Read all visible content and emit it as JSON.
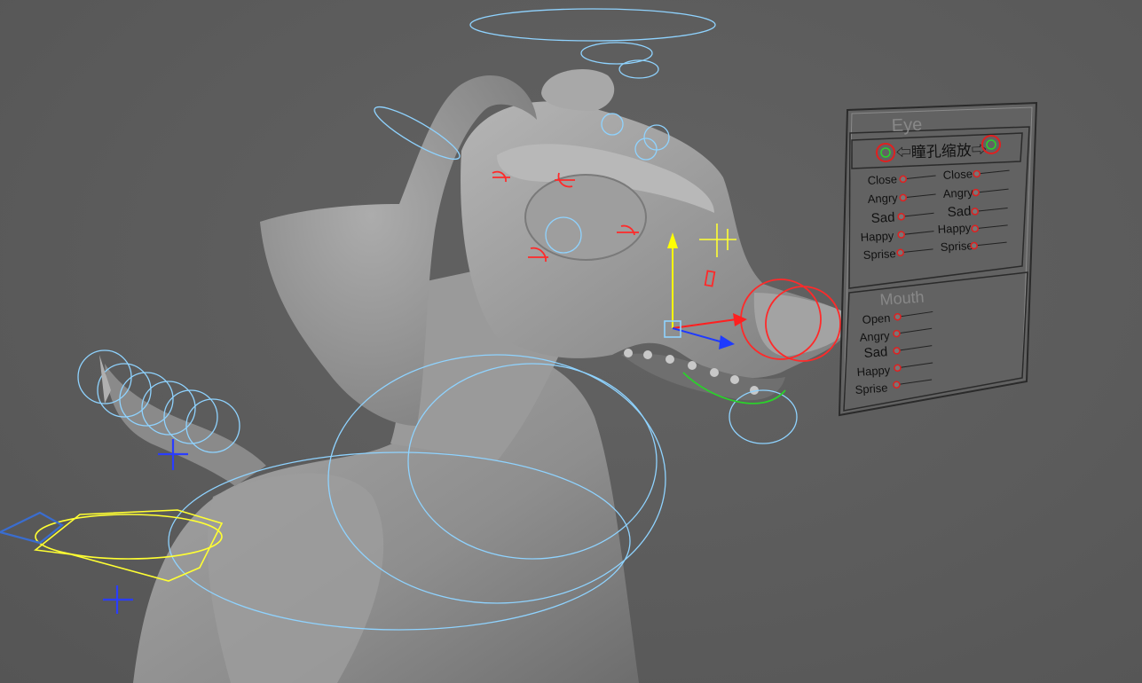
{
  "viewport": {
    "background": "#5a5a5a",
    "model": "dog-character",
    "colors": {
      "ik_control": "#8fd3ff",
      "fk_control": "#ff2a2a",
      "selected_control": "#ffff33",
      "jaw_control": "#2bd12b",
      "axis_x": "#ff2020",
      "axis_y": "#ffff00",
      "axis_z": "#1f3bff"
    }
  },
  "face_panel": {
    "eye_section": {
      "title": "Eye",
      "pupil_label": "⇦瞳孔缩放⇨",
      "left_sliders": [
        "Close",
        "Angry",
        "Sad",
        "Happy",
        "Sprise"
      ],
      "right_sliders": [
        "Close",
        "Angry",
        "Sad",
        "Happy",
        "Sprise"
      ]
    },
    "mouth_section": {
      "title": "Mouth",
      "sliders": [
        "Open",
        "Angry",
        "Sad",
        "Happy",
        "Sprise"
      ]
    }
  }
}
